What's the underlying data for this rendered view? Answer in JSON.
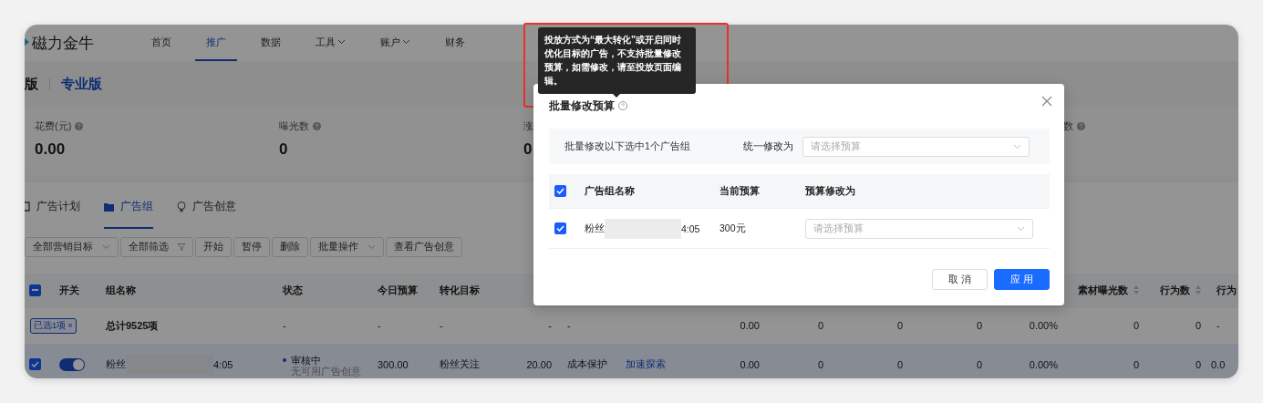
{
  "nav": {
    "logo": "磁力金牛",
    "items": [
      {
        "label": "首页",
        "selected": false,
        "dropdown": false
      },
      {
        "label": "推广",
        "selected": true,
        "dropdown": false
      },
      {
        "label": "数据",
        "selected": false,
        "dropdown": false
      },
      {
        "label": "工具",
        "selected": false,
        "dropdown": true
      },
      {
        "label": "账户",
        "selected": false,
        "dropdown": true
      },
      {
        "label": "财务",
        "selected": false,
        "dropdown": false
      }
    ]
  },
  "versions": [
    {
      "label": "版",
      "selected": false
    },
    {
      "label": "专业版",
      "selected": true
    }
  ],
  "stats": [
    {
      "label": "花费(元)",
      "value": "0.00",
      "help": true
    },
    {
      "label": "曝光数",
      "value": "0",
      "help": true
    },
    {
      "label": "涨",
      "value": "0",
      "help": false
    },
    {
      "label": "数",
      "help": true
    }
  ],
  "tabs": [
    {
      "label": "广告计划",
      "selected": false
    },
    {
      "label": "广告组",
      "selected": true
    },
    {
      "label": "广告创意",
      "selected": false
    }
  ],
  "toolbar": [
    {
      "label": "全部营销目标",
      "kind": "select"
    },
    {
      "label": "全部筛选",
      "kind": "filter"
    },
    {
      "label": "开始",
      "kind": "button"
    },
    {
      "label": "暂停",
      "kind": "button"
    },
    {
      "label": "删除",
      "kind": "button"
    },
    {
      "label": "批量操作",
      "kind": "select"
    },
    {
      "label": "查看广告创意",
      "kind": "button"
    }
  ],
  "table": {
    "header_checkbox": {
      "indeterminate": true
    },
    "columns": [
      {
        "label": "开关"
      },
      {
        "label": "组名称"
      },
      {
        "label": "状态"
      },
      {
        "label": "今日预算"
      },
      {
        "label": "转化目标"
      },
      {},
      {},
      {},
      {},
      {},
      {},
      {},
      {},
      {
        "label": "素材曝光数",
        "sortable": true
      },
      {
        "label": "行为数",
        "sortable": true
      },
      {
        "label": "行为"
      }
    ],
    "total": {
      "tag": "已选1项",
      "tag_close": "×",
      "cells": [
        "",
        "总计9525项",
        "-",
        "-",
        "-",
        "-",
        "-",
        "",
        "0.00",
        "0",
        "0",
        "0",
        "0.00%",
        "0",
        "0",
        "-"
      ]
    },
    "rows": [
      {
        "selected": true,
        "on": true,
        "name_suffix": "4:05",
        "status_note": "无可用广告创意",
        "cells": [
          "",
          "粉丝",
          "审核中",
          "300.00",
          "粉丝关注",
          "20.00",
          "成本保护",
          "加速探索",
          "0.00",
          "0",
          "0",
          "0",
          "0.00%",
          "0",
          "0",
          "0.0"
        ]
      }
    ]
  },
  "tooltip": "投放方式为“最大转化”或开启同时优化目标的广告，不支持批量修改预算，如需修改，请至投放页面编辑。",
  "modal": {
    "title": "批量修改预算",
    "info": "批量修改以下选中1个广告组",
    "unify_label": "统一修改为",
    "unify_placeholder": "请选择预算",
    "columns": [
      "广告组名称",
      "当前预算",
      "预算修改为"
    ],
    "header_checked": true,
    "rows": [
      {
        "checked": true,
        "name_prefix": "粉丝",
        "name_suffix": "4:05",
        "budget": "300元",
        "placeholder": "请选择预算"
      }
    ],
    "buttons": [
      {
        "label": "取 消",
        "kind": "secondary"
      },
      {
        "label": "应 用",
        "kind": "primary"
      }
    ]
  }
}
